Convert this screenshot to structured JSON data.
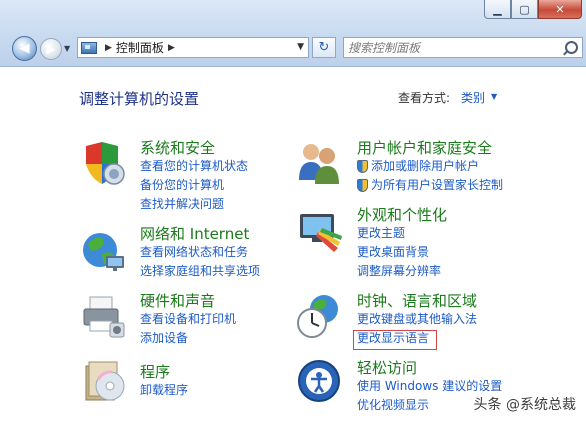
{
  "window": {
    "minimize_glyph": "▁",
    "maximize_glyph": "▢",
    "close_glyph": "✕"
  },
  "navbar": {
    "breadcrumb": [
      "控制面板"
    ],
    "search_placeholder": "搜索控制面板"
  },
  "header": {
    "title": "调整计算机的设置",
    "view_by_label": "查看方式:",
    "view_by_value": "类别"
  },
  "categories": [
    {
      "title": "系统和安全",
      "icon": "security-shield-icon",
      "links": [
        "查看您的计算机状态",
        "备份您的计算机",
        "查找并解决问题"
      ]
    },
    {
      "title": "网络和 Internet",
      "icon": "network-globe-icon",
      "links": [
        "查看网络状态和任务",
        "选择家庭组和共享选项"
      ]
    },
    {
      "title": "硬件和声音",
      "icon": "printer-icon",
      "links": [
        "查看设备和打印机",
        "添加设备"
      ]
    },
    {
      "title": "程序",
      "icon": "programs-disc-icon",
      "links": [
        "卸载程序"
      ]
    },
    {
      "title": "用户帐户和家庭安全",
      "icon": "users-icon",
      "links": [
        "添加或删除用户帐户",
        "为所有用户设置家长控制"
      ]
    },
    {
      "title": "外观和个性化",
      "icon": "appearance-monitor-icon",
      "links": [
        "更改主题",
        "更改桌面背景",
        "调整屏幕分辨率"
      ]
    },
    {
      "title": "时钟、语言和区域",
      "icon": "clock-globe-icon",
      "links": [
        "更改键盘或其他输入法",
        "更改显示语言"
      ]
    },
    {
      "title": "轻松访问",
      "icon": "ease-of-access-icon",
      "links": [
        "使用 Windows 建议的设置",
        "优化视频显示"
      ]
    }
  ],
  "watermark": {
    "text": "头条 @系统总裁"
  },
  "colors": {
    "category_title": "#1b7a1b",
    "link": "#1e5bc6",
    "highlight": "#d64545"
  }
}
